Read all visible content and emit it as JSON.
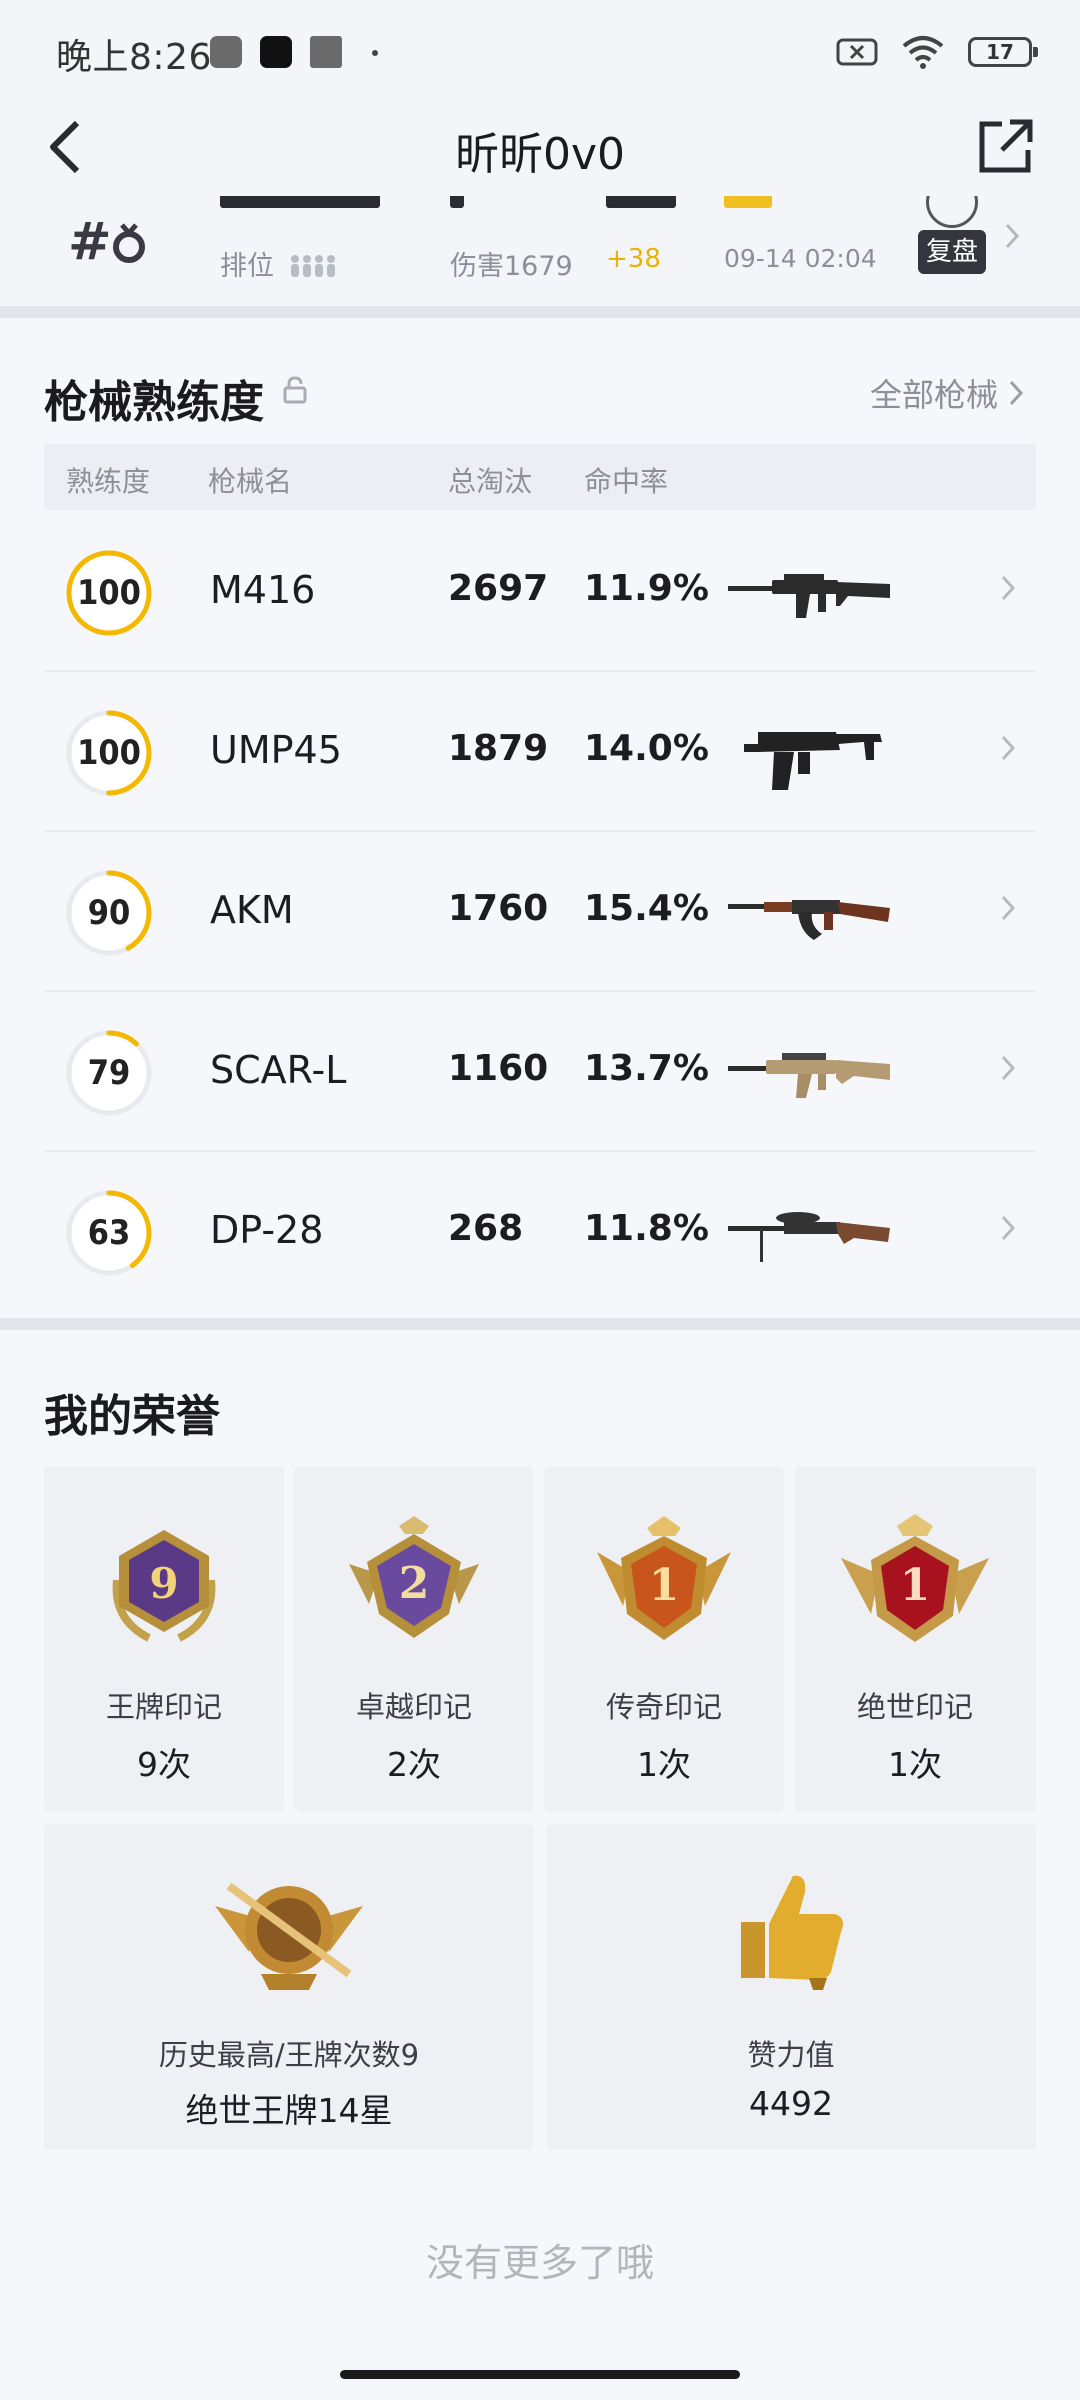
{
  "status_bar": {
    "time": "晚上8:26",
    "battery": "17"
  },
  "header": {
    "title": "昕昕0v0"
  },
  "recent_match": {
    "rank_prefix": "#",
    "mode_label": "排位",
    "damage_label": "伤害1679",
    "rating_delta": "+38",
    "date": "09-14 02:04",
    "replay_label": "复盘"
  },
  "weapons": {
    "title": "枪械熟练度",
    "all_link": "全部枪械",
    "columns": [
      "熟练度",
      "枪械名",
      "总淘汰",
      "命中率"
    ],
    "rows": [
      {
        "level": "100",
        "level_fraction": 1.0,
        "name": "M416",
        "eliminations": "2697",
        "accuracy": "11.9%",
        "weapon_icon": "assault-rifle-icon"
      },
      {
        "level": "100",
        "level_fraction": 0.5,
        "name": "UMP45",
        "eliminations": "1879",
        "accuracy": "14.0%",
        "weapon_icon": "smg-icon"
      },
      {
        "level": "90",
        "level_fraction": 0.42,
        "name": "AKM",
        "eliminations": "1760",
        "accuracy": "15.4%",
        "weapon_icon": "ak-rifle-icon"
      },
      {
        "level": "79",
        "level_fraction": 0.12,
        "name": "SCAR-L",
        "eliminations": "1160",
        "accuracy": "13.7%",
        "weapon_icon": "scar-rifle-icon"
      },
      {
        "level": "63",
        "level_fraction": 0.4,
        "name": "DP-28",
        "eliminations": "268",
        "accuracy": "11.8%",
        "weapon_icon": "lmg-icon"
      }
    ],
    "accent_color": "#f5b800"
  },
  "honors": {
    "title": "我的荣誉",
    "items": [
      {
        "name": "王牌印记",
        "count": "9次",
        "badge_number": "9",
        "icon": "ace-emblem-icon"
      },
      {
        "name": "卓越印记",
        "count": "2次",
        "badge_number": "2",
        "icon": "excellence-emblem-icon"
      },
      {
        "name": "传奇印记",
        "count": "1次",
        "badge_number": "1",
        "icon": "legend-emblem-icon"
      },
      {
        "name": "绝世印记",
        "count": "1次",
        "badge_number": "1",
        "icon": "peerless-emblem-icon"
      }
    ],
    "wide": [
      {
        "name": "历史最高/王牌次数9",
        "value": "绝世王牌14星",
        "icon": "highest-rank-emblem-icon"
      },
      {
        "name": "赞力值",
        "value": "4492",
        "icon": "thumbs-up-icon"
      }
    ]
  },
  "footer": {
    "text": "没有更多了哦"
  }
}
